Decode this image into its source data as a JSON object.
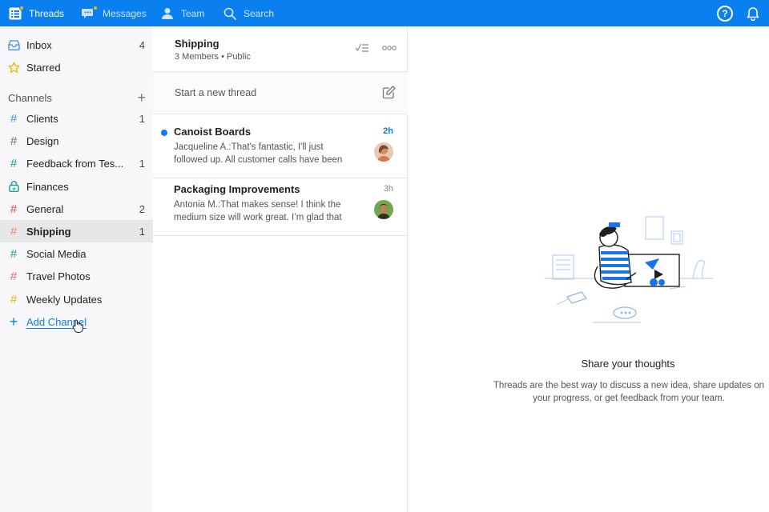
{
  "nav": {
    "threads": "Threads",
    "messages": "Messages",
    "team": "Team",
    "search": "Search",
    "help": "?"
  },
  "sidebar": {
    "inbox": {
      "label": "Inbox",
      "count": "4"
    },
    "starred": {
      "label": "Starred"
    },
    "channels_heading": "Channels",
    "channels": [
      {
        "label": "Clients",
        "count": "1",
        "color": "#3d8ef0"
      },
      {
        "label": "Design",
        "count": "",
        "color": "#6b6b73"
      },
      {
        "label": "Feedback from Tes...",
        "count": "1",
        "color": "#1a9e8f"
      },
      {
        "label": "Finances",
        "count": "",
        "color": "#1a9e8f"
      },
      {
        "label": "General",
        "count": "2",
        "color": "#e0484f"
      },
      {
        "label": "Shipping",
        "count": "1",
        "color": "#f08a5d"
      },
      {
        "label": "Social Media",
        "count": "",
        "color": "#1a9e8f"
      },
      {
        "label": "Travel Photos",
        "count": "",
        "color": "#e85f9a"
      },
      {
        "label": "Weekly Updates",
        "count": "",
        "color": "#f4b400"
      }
    ],
    "add_channel": "Add Channel"
  },
  "channel_header": {
    "title": "Shipping",
    "subtitle": "3 Members • Public"
  },
  "new_thread": {
    "placeholder": "Start a new thread"
  },
  "threads": [
    {
      "title": "Canoist Boards",
      "time": "2h",
      "unread": true,
      "snippet": "Jacqueline A.:That's fantastic, I'll just followed up. All customer calls have been"
    },
    {
      "title": "Packaging Improvements",
      "time": "3h",
      "unread": false,
      "snippet": "Antonia M.:That makes sense! I think the medium size will work great. I’m glad that"
    }
  ],
  "empty_state": {
    "title": "Share your thoughts",
    "text": "Threads are the best way to discuss a new idea, share updates on your progress, or get feedback from your team."
  },
  "colors": {
    "brand": "#0a7ff0",
    "sidebar_bg": "#f7f6f8",
    "selected_bg": "#e7e6e9",
    "unread_dot": "#0a7ff0",
    "notification_dot": "#f4b400"
  }
}
